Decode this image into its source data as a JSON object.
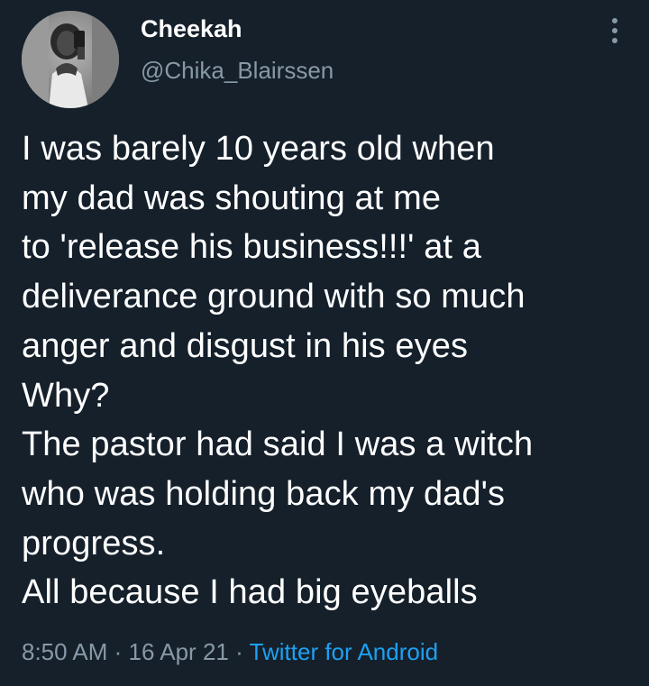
{
  "author": {
    "display_name": "Cheekah",
    "handle": "@Chika_Blairssen"
  },
  "tweet": {
    "lines": [
      "I was barely 10 years old when",
      "my dad was shouting at me",
      "to 'release his business!!!' at a",
      "deliverance ground with so much",
      "anger and disgust in his eyes",
      "Why?",
      "The pastor had said I was a witch",
      "who was holding back my dad's",
      "progress.",
      "All because I had big eyeballs"
    ]
  },
  "meta": {
    "time": "8:50 AM",
    "separator": "·",
    "date": "16 Apr 21",
    "source": "Twitter for Android"
  },
  "icons": {
    "more": "more-vertical-icon",
    "avatar": "profile-photo"
  },
  "colors": {
    "background": "#15202b",
    "text": "#ffffff",
    "secondary": "#8899a6",
    "link": "#1da1f2"
  }
}
